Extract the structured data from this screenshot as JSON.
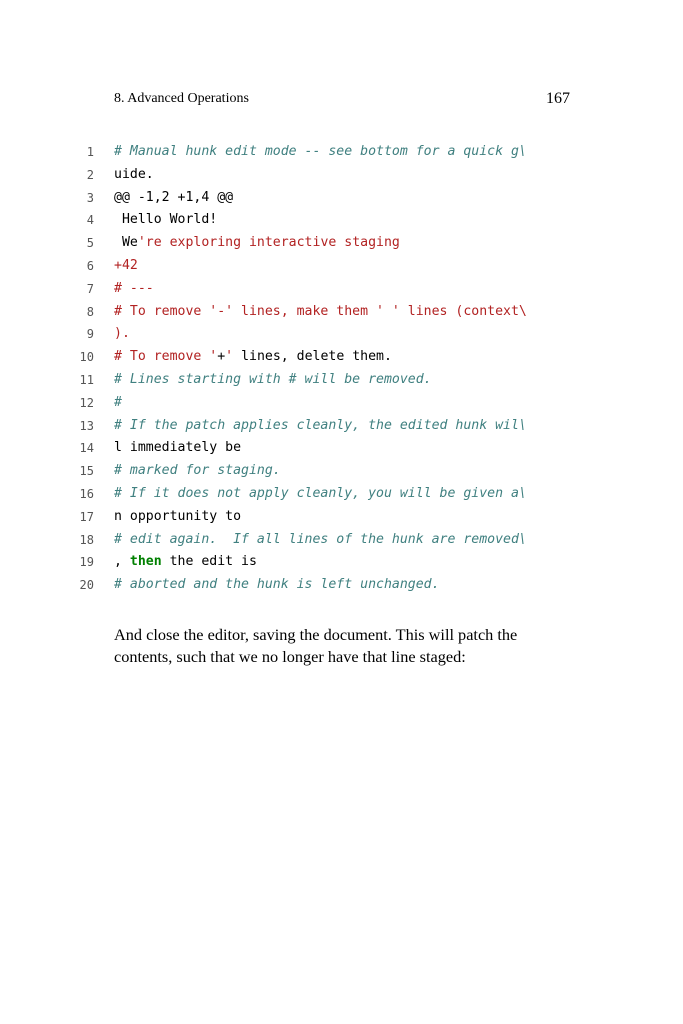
{
  "header": {
    "chapter": "8. Advanced Operations",
    "page_number": "167"
  },
  "code": {
    "lines": [
      {
        "num": "1",
        "segments": [
          {
            "text": "# Manual hunk edit mode -- see bottom for a quick g\\",
            "style": "comment"
          }
        ]
      },
      {
        "num": "2",
        "segments": [
          {
            "text": "uide.",
            "style": "plain"
          }
        ]
      },
      {
        "num": "3",
        "segments": [
          {
            "text": "@@ -1,2 +1,4 @@",
            "style": "plain"
          }
        ]
      },
      {
        "num": "4",
        "segments": [
          {
            "text": " Hello World!",
            "style": "plain"
          }
        ]
      },
      {
        "num": "5",
        "segments": [
          {
            "text": " We",
            "style": "plain"
          },
          {
            "text": "'re exploring interactive staging",
            "style": "red"
          }
        ]
      },
      {
        "num": "6",
        "segments": [
          {
            "text": "+42",
            "style": "red"
          }
        ]
      },
      {
        "num": "7",
        "segments": [
          {
            "text": "# ---",
            "style": "red"
          }
        ]
      },
      {
        "num": "8",
        "segments": [
          {
            "text": "# To remove '-' lines, make them ' ' lines (context\\",
            "style": "red"
          }
        ]
      },
      {
        "num": "9",
        "segments": [
          {
            "text": ").",
            "style": "red"
          }
        ]
      },
      {
        "num": "10",
        "segments": [
          {
            "text": "# To remove '",
            "style": "red"
          },
          {
            "text": "+",
            "style": "plain"
          },
          {
            "text": "'",
            "style": "red"
          },
          {
            "text": " lines, delete them.",
            "style": "plain"
          }
        ]
      },
      {
        "num": "11",
        "segments": [
          {
            "text": "# Lines starting with # will be removed.",
            "style": "comment"
          }
        ]
      },
      {
        "num": "12",
        "segments": [
          {
            "text": "#",
            "style": "comment"
          }
        ]
      },
      {
        "num": "13",
        "segments": [
          {
            "text": "# If the patch applies cleanly, the edited hunk wil\\",
            "style": "comment"
          }
        ]
      },
      {
        "num": "14",
        "segments": [
          {
            "text": "l immediately be",
            "style": "plain"
          }
        ]
      },
      {
        "num": "15",
        "segments": [
          {
            "text": "# marked for staging.",
            "style": "comment"
          }
        ]
      },
      {
        "num": "16",
        "segments": [
          {
            "text": "# If it does not apply cleanly, you will be given a\\",
            "style": "comment"
          }
        ]
      },
      {
        "num": "17",
        "segments": [
          {
            "text": "n opportunity to",
            "style": "plain"
          }
        ]
      },
      {
        "num": "18",
        "segments": [
          {
            "text": "# edit again.  If all lines of the hunk are removed\\",
            "style": "comment"
          }
        ]
      },
      {
        "num": "19",
        "segments": [
          {
            "text": ", ",
            "style": "plain"
          },
          {
            "text": "then",
            "style": "kw"
          },
          {
            "text": " the edit is",
            "style": "plain"
          }
        ]
      },
      {
        "num": "20",
        "segments": [
          {
            "text": "# aborted and the hunk is left unchanged.",
            "style": "comment"
          }
        ]
      }
    ]
  },
  "body_text": "And close the editor, saving the document. This will patch the contents, such that we no longer have that line staged:",
  "colors": {
    "comment": "#408080",
    "red": "#b22222",
    "keyword": "#008000",
    "line_number": "#555555"
  }
}
